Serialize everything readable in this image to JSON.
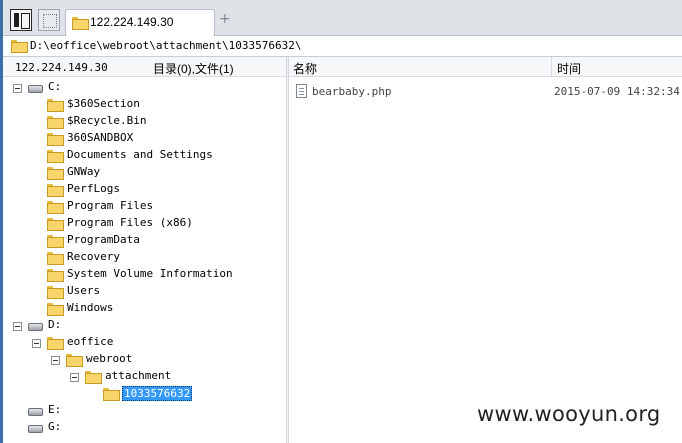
{
  "tab": {
    "label": "122.224.149.30",
    "add": "+"
  },
  "path": "D:\\eoffice\\webroot\\attachment\\1033576632\\",
  "header": {
    "host": "122.224.149.30",
    "count": "目录(0),文件(1)",
    "name": "名称",
    "time": "时间"
  },
  "tree": {
    "c": "C:",
    "c_folders": [
      "$360Section",
      "$Recycle.Bin",
      "360SANDBOX",
      "Documents and Settings",
      "GNWay",
      "PerfLogs",
      "Program Files",
      "Program Files (x86)",
      "ProgramData",
      "Recovery",
      "System Volume Information",
      "Users",
      "Windows"
    ],
    "d": "D:",
    "eoffice": "eoffice",
    "webroot": "webroot",
    "attachment": "attachment",
    "selected": "1033576632",
    "e": "E:",
    "g": "G:"
  },
  "files": [
    {
      "name": "bearbaby.php",
      "time": "2015-07-09 14:32:34"
    }
  ],
  "watermark": "www.wooyun.org",
  "icons": [
    "panel-toggle-icon",
    "blank-tab-icon",
    "folder-icon",
    "drive-icon",
    "collapse-icon",
    "file-icon"
  ]
}
